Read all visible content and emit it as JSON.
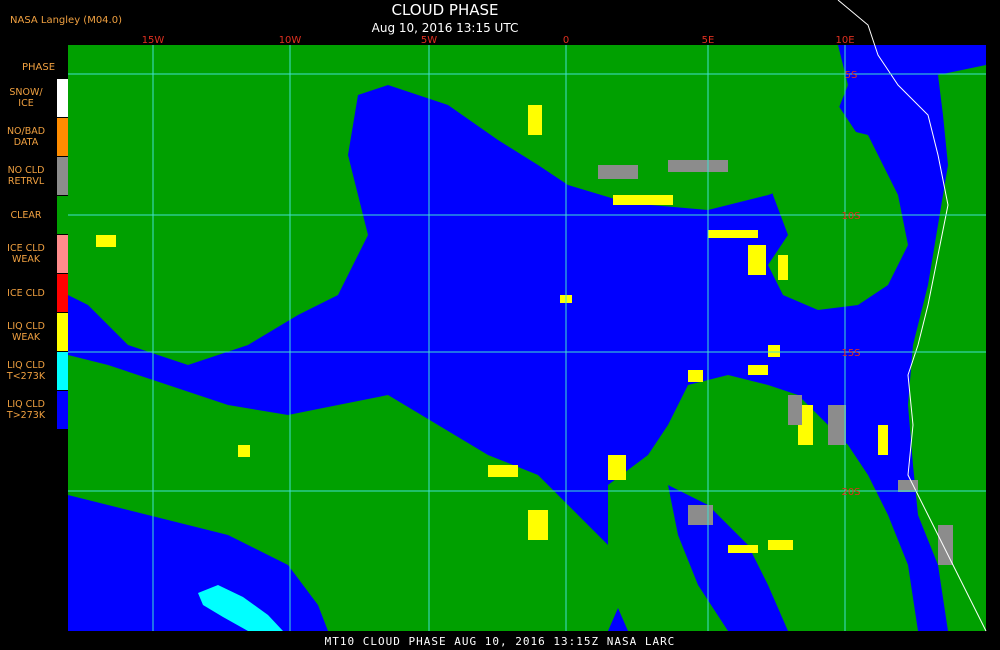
{
  "header": {
    "title": "CLOUD PHASE",
    "subtitle": "Aug 10, 2016 13:15 UTC",
    "producer": "NASA Langley (M04.0)"
  },
  "legend": {
    "title": "PHASE",
    "items": [
      {
        "label_line1": "SNOW/",
        "label_line2": "ICE",
        "color": "#ffffff"
      },
      {
        "label_line1": "NO/BAD",
        "label_line2": "DATA",
        "color": "#ff8c00"
      },
      {
        "label_line1": "NO CLD",
        "label_line2": "RETRVL",
        "color": "#8c8c8c"
      },
      {
        "label_line1": "CLEAR",
        "label_line2": "",
        "color": "#00a000"
      },
      {
        "label_line1": "ICE CLD",
        "label_line2": "WEAK",
        "color": "#ff8c8c"
      },
      {
        "label_line1": "ICE CLD",
        "label_line2": "",
        "color": "#ff0000"
      },
      {
        "label_line1": "LIQ CLD",
        "label_line2": "WEAK",
        "color": "#ffff00"
      },
      {
        "label_line1": "LIQ CLD",
        "label_line2": "T<273K",
        "color": "#00ffff"
      },
      {
        "label_line1": "LIQ CLD",
        "label_line2": "T>273K",
        "color": "#0000ff"
      }
    ]
  },
  "map": {
    "longitude_labels": [
      "15W",
      "10W",
      "5W",
      "0",
      "5E",
      "10E"
    ],
    "latitude_labels": [
      "5S",
      "10S",
      "15S",
      "20S"
    ],
    "grid_color": "#40e0d0",
    "ocean_color": "#0000ff",
    "land_color": "#00a000"
  },
  "footer": {
    "text": "MT10   CLOUD PHASE   AUG 10, 2016 13:15Z   NASA LARC"
  }
}
